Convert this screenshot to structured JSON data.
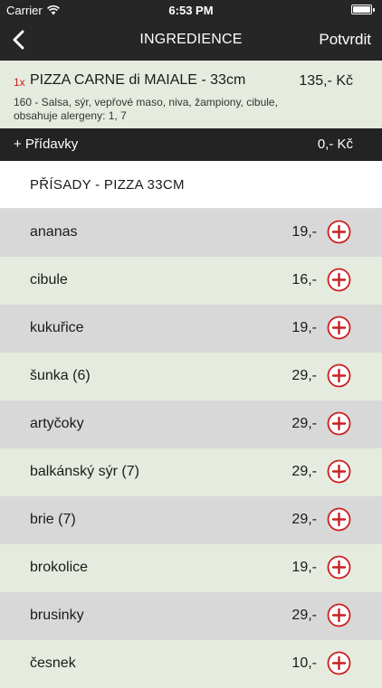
{
  "status_bar": {
    "carrier": "Carrier",
    "time": "6:53 PM"
  },
  "nav": {
    "title": "INGREDIENCE",
    "confirm_label": "Potvrdit"
  },
  "product": {
    "quantity": "1x",
    "name": "PIZZA CARNE di MAIALE - 33cm",
    "price": "135,- Kč",
    "description": "160 - Salsa, sýr, vepřové maso, niva, žampiony, cibule, obsahuje alergeny: 1, 7"
  },
  "addons": {
    "label": "+ Přídavky",
    "value": "0,- Kč"
  },
  "section": {
    "title": "PŘÍSADY - PIZZA 33CM"
  },
  "ingredients": [
    {
      "name": "ananas",
      "price": "19,-"
    },
    {
      "name": "cibule",
      "price": "16,-"
    },
    {
      "name": "kukuřice",
      "price": "19,-"
    },
    {
      "name": "šunka (6)",
      "price": "29,-"
    },
    {
      "name": "artyčoky",
      "price": "29,-"
    },
    {
      "name": "balkánský sýr (7)",
      "price": "29,-"
    },
    {
      "name": "brie (7)",
      "price": "29,-"
    },
    {
      "name": "brokolice",
      "price": "19,-"
    },
    {
      "name": "brusinky",
      "price": "29,-"
    },
    {
      "name": "česnek",
      "price": "10,-"
    }
  ],
  "colors": {
    "header_bg": "#262626",
    "row_gray": "#d8d8d8",
    "row_green": "#e5ecdf",
    "accent_red": "#cc1f1f"
  },
  "icons": {
    "back": "chevron-left-icon",
    "add": "plus-circle-icon",
    "wifi": "wifi-icon",
    "battery": "battery-icon"
  }
}
